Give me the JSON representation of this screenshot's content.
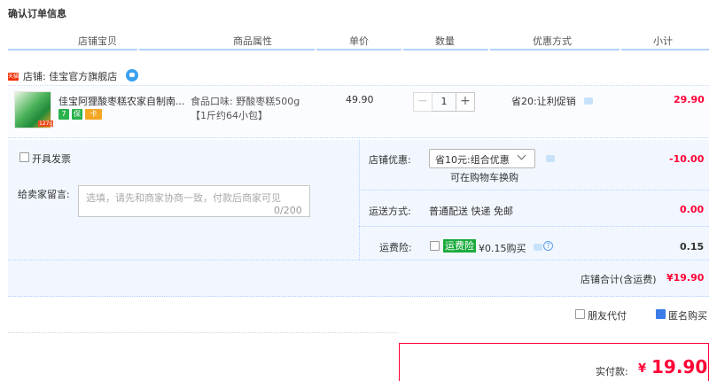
{
  "page": {
    "title": "确认订单信息"
  },
  "columns": [
    "店铺宝贝",
    "商品属性",
    "单价",
    "数量",
    "优惠方式",
    "小计"
  ],
  "shop": {
    "badge": "天猫",
    "label": "店铺: 佳宝官方旗舰店"
  },
  "item": {
    "title": "佳宝阿狸酸枣糕农家自制南...",
    "thumb_label": "127g",
    "service_icons": [
      "7",
      "保",
      "卡"
    ],
    "attr_line1": "食品口味: 野酸枣糕500g",
    "attr_line2": "【1斤约64小包】",
    "unit_price": "49.90",
    "quantity": "1",
    "minus": "−",
    "plus": "+",
    "promo": "省20:让利促销",
    "subtotal": "29.90"
  },
  "invoice": {
    "label": "开具发票"
  },
  "message": {
    "label": "给卖家留言:",
    "placeholder": "选填，请先和商家协商一致，付款后商家可见",
    "counter": "0/200"
  },
  "shop_discount": {
    "label": "店铺优惠:",
    "selected": "省10元:组合优惠",
    "note": "可在购物车换购",
    "amount": "-10.00"
  },
  "shipping": {
    "label": "运送方式:",
    "value": "普通配送 快递 免邮",
    "amount": "0.00"
  },
  "insurance": {
    "label": "运费险:",
    "badge": "运费险",
    "price": "¥0.15购买",
    "help": "?",
    "amount": "0.15"
  },
  "shop_total": {
    "label": "店铺合计(含运费)",
    "amount": "¥19.90"
  },
  "options": {
    "anonymous": "匿名购买",
    "friend_pay": "朋友代付"
  },
  "payment": {
    "label": "实付款:",
    "currency": "¥",
    "amount": "19.90"
  },
  "colors": {
    "accent_red": "#ff0036",
    "border_blue": "#b2d1ff",
    "panel_bg": "#f2f7ff",
    "badge_green": "#1aab3d"
  }
}
